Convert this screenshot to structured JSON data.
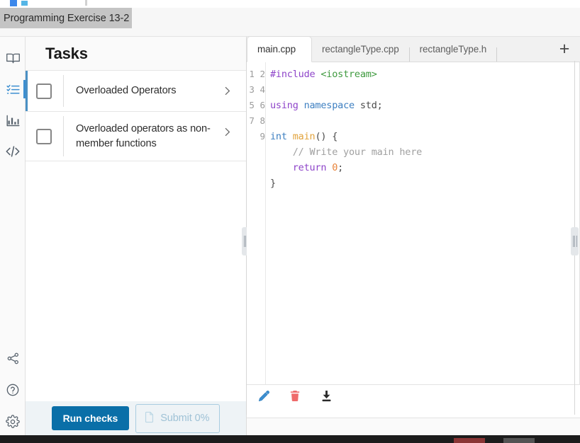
{
  "browser": {
    "address_value": "Programming Exercise 13-2"
  },
  "rail": {
    "items": [
      {
        "icon": "book-icon",
        "name": "rail-item-materials",
        "active": false
      },
      {
        "icon": "checklist-icon",
        "name": "rail-item-tasks",
        "active": true
      },
      {
        "icon": "chart-icon",
        "name": "rail-item-progress",
        "active": false
      },
      {
        "icon": "code-icon",
        "name": "rail-item-code",
        "active": false
      }
    ],
    "bottom_items": [
      {
        "icon": "share-icon",
        "name": "rail-item-share"
      },
      {
        "icon": "help-icon",
        "name": "rail-item-help"
      },
      {
        "icon": "settings-icon",
        "name": "rail-item-settings"
      }
    ]
  },
  "tasks": {
    "title": "Tasks",
    "items": [
      {
        "label": "Overloaded Operators",
        "checked": false,
        "selected": true
      },
      {
        "label": "Overloaded operators as non-member functions",
        "checked": false,
        "selected": false
      }
    ],
    "footer": {
      "run_label": "Run checks",
      "submit_label": "Submit 0%",
      "submit_icon": "document-icon"
    }
  },
  "editor": {
    "tabs": [
      {
        "label": "main.cpp",
        "active": true
      },
      {
        "label": "rectangleType.cpp",
        "active": false
      },
      {
        "label": "rectangleType.h",
        "active": false
      }
    ],
    "add_tab_label": "+",
    "line_numbers": "1\n2\n3\n4\n5\n6\n7\n8\n9",
    "code_lines": [
      {
        "n": 1,
        "tokens": [
          {
            "t": "#include ",
            "c": "tok-pre"
          },
          {
            "t": "<iostream>",
            "c": "tok-str"
          }
        ]
      },
      {
        "n": 2,
        "tokens": []
      },
      {
        "n": 3,
        "tokens": [
          {
            "t": "using ",
            "c": "tok-kw"
          },
          {
            "t": "namespace ",
            "c": "tok-ns"
          },
          {
            "t": "std;",
            "c": "tok-plain"
          }
        ]
      },
      {
        "n": 4,
        "tokens": []
      },
      {
        "n": 5,
        "tokens": [
          {
            "t": "int ",
            "c": "tok-type"
          },
          {
            "t": "main",
            "c": "tok-fn"
          },
          {
            "t": "() {",
            "c": "tok-plain"
          }
        ]
      },
      {
        "n": 6,
        "tokens": [
          {
            "t": "    // Write your main here",
            "c": "tok-cmt"
          }
        ]
      },
      {
        "n": 7,
        "tokens": [
          {
            "t": "    return ",
            "c": "tok-kw"
          },
          {
            "t": "0",
            "c": "tok-num"
          },
          {
            "t": ";",
            "c": "tok-plain"
          }
        ]
      },
      {
        "n": 8,
        "tokens": [
          {
            "t": "}",
            "c": "tok-plain"
          }
        ]
      },
      {
        "n": 9,
        "tokens": []
      }
    ],
    "toolbar": [
      {
        "icon": "pencil-icon",
        "name": "edit-file-button",
        "color": "#3d8fd1"
      },
      {
        "icon": "trash-icon",
        "name": "delete-file-button",
        "color": "#ef6b6b"
      },
      {
        "icon": "download-icon",
        "name": "download-file-button",
        "color": "#2b2b2b"
      }
    ]
  },
  "colors": {
    "accent": "#0a6fa8",
    "rail_active": "#3d8fd1",
    "task_selected": "#4a90c4",
    "footer_bg": "#eef3f6"
  }
}
